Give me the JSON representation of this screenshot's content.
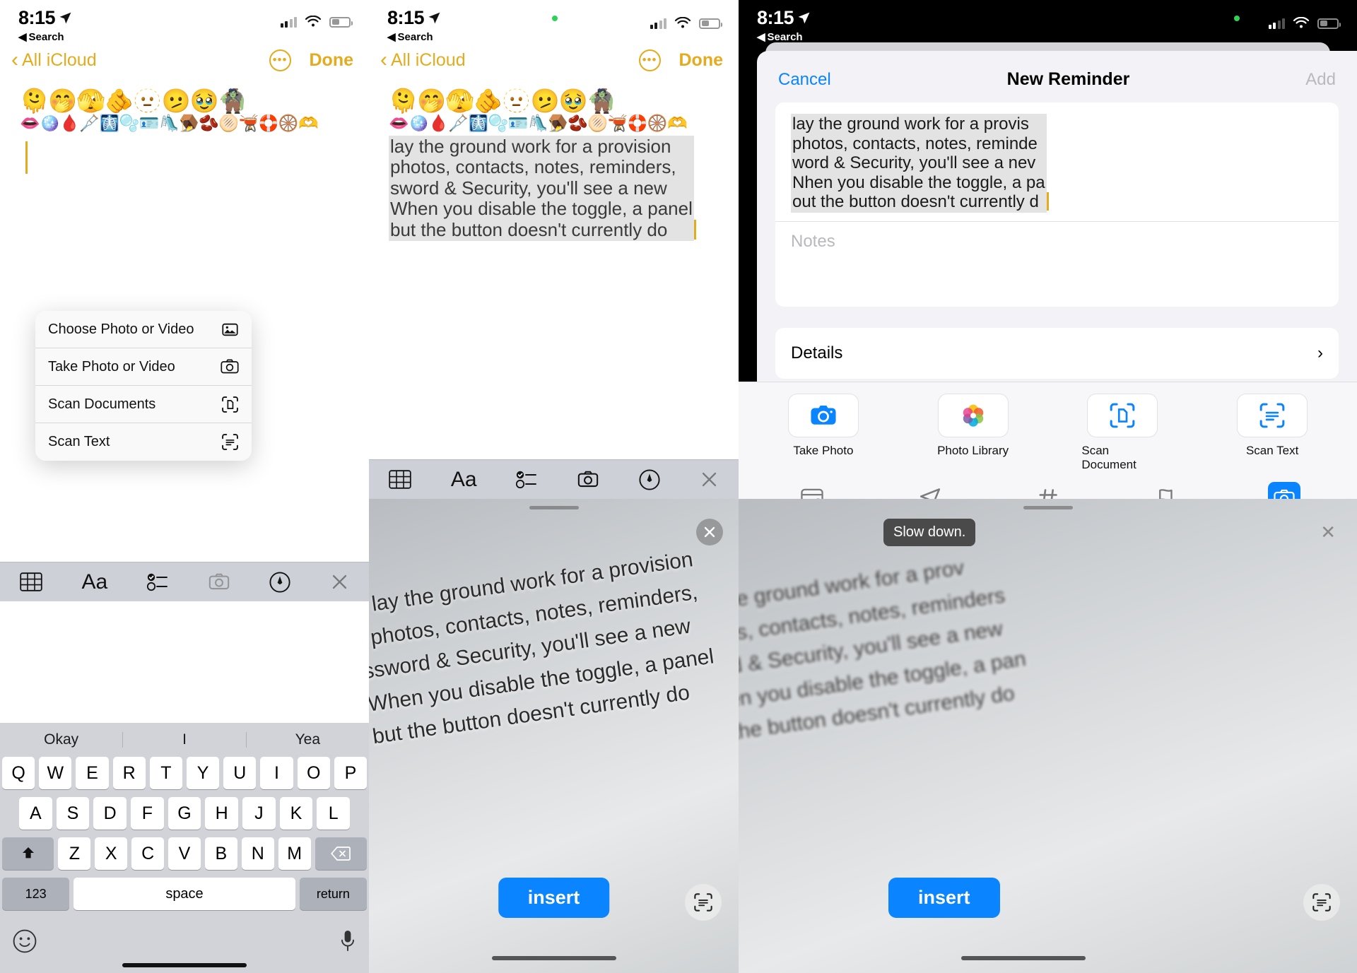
{
  "status_bar": {
    "time": "8:15",
    "location_icon": "location-arrow-icon",
    "back_label": "Search",
    "signal_icon": "cellular-signal-icon",
    "wifi_icon": "wifi-icon",
    "battery_icon": "battery-icon"
  },
  "notes": {
    "nav": {
      "back_label": "All iCloud",
      "more_icon": "ellipsis-circle-icon",
      "done_label": "Done"
    },
    "emoji_row_1": [
      "🫠",
      "🤭",
      "🫣",
      "🫵",
      "🫥",
      "🫤",
      "🥹",
      "🧌"
    ],
    "emoji_row_2": [
      "👄",
      "🪩",
      "🩸",
      "🩼",
      "🩻",
      "🫧",
      "🪪",
      "🛝",
      "🪤",
      "🫘",
      "🫓",
      "🫕",
      "🛟",
      "🛞",
      "🫶"
    ],
    "selected_text_lines": [
      "lay the ground work for a provision",
      "photos, contacts, notes, reminders,",
      "sword & Security, you'll see a new",
      "When you disable the toggle, a panel",
      "but the button doesn't currently do"
    ],
    "context_menu": [
      {
        "label": "Choose Photo or Video",
        "icon": "photo-icon"
      },
      {
        "label": "Take Photo or Video",
        "icon": "camera-icon"
      },
      {
        "label": "Scan Documents",
        "icon": "scan-document-icon"
      },
      {
        "label": "Scan Text",
        "icon": "scan-text-icon"
      }
    ],
    "toolbar": [
      {
        "icon": "table-icon",
        "name": "table-button"
      },
      {
        "icon": "text-format-icon",
        "name": "format-button",
        "glyph": "Aa"
      },
      {
        "icon": "checklist-icon",
        "name": "checklist-button"
      },
      {
        "icon": "camera-icon",
        "name": "camera-button"
      },
      {
        "icon": "markup-pen-icon",
        "name": "markup-button"
      },
      {
        "icon": "close-icon",
        "name": "close-keyboard-button"
      }
    ]
  },
  "keyboard": {
    "suggestions": [
      "Okay",
      "I",
      "Yea"
    ],
    "row1": [
      "Q",
      "W",
      "E",
      "R",
      "T",
      "Y",
      "U",
      "I",
      "O",
      "P"
    ],
    "row2": [
      "A",
      "S",
      "D",
      "F",
      "G",
      "H",
      "J",
      "K",
      "L"
    ],
    "row3": [
      "Z",
      "X",
      "C",
      "V",
      "B",
      "N",
      "M"
    ],
    "shift_icon": "shift-up-icon",
    "delete_icon": "delete-backspace-icon",
    "numbers_label": "123",
    "space_label": "space",
    "return_label": "return",
    "emoji_icon": "emoji-smiley-icon",
    "mic_icon": "microphone-icon"
  },
  "camera_scan": {
    "close_icon": "close-circle-icon",
    "insert_label": "insert",
    "scan_icon": "live-text-scan-icon",
    "tooltip": "Slow down.",
    "document_lines": [
      "o lay the ground work for a provision",
      ", photos, contacts, notes, reminders,",
      "ssword & Security, you'll see a new",
      "When you disable the toggle, a panel",
      "but the button doesn't currently do"
    ],
    "document_lines_right": [
      "y the ground work for a prov",
      "otos, contacts, notes, reminders",
      "ord & Security, you'll see a new",
      "hen you disable the toggle, a pan",
      "t the button doesn't currently do"
    ]
  },
  "reminder": {
    "cancel_label": "Cancel",
    "title": "New Reminder",
    "add_label": "Add",
    "title_lines": [
      "lay the ground work for a provis",
      "photos, contacts, notes, reminde",
      "word & Security, you'll see a nev",
      "Nhen you disable the toggle, a pa",
      "out the button doesn't currently d"
    ],
    "notes_placeholder": "Notes",
    "details_label": "Details",
    "details_chevron": "chevron-right-icon",
    "quick_actions": [
      {
        "label": "Take Photo",
        "icon": "camera-icon"
      },
      {
        "label": "Photo Library",
        "icon": "photos-app-icon"
      },
      {
        "label": "Scan Document",
        "icon": "scan-document-icon"
      },
      {
        "label": "Scan Text",
        "icon": "scan-text-icon"
      }
    ],
    "quick_icons": [
      {
        "name": "calendar-clock-icon"
      },
      {
        "name": "location-arrow-icon"
      },
      {
        "name": "hashtag-icon"
      },
      {
        "name": "flag-icon"
      },
      {
        "name": "camera-icon"
      }
    ]
  },
  "colors": {
    "notes_accent": "#e5ab1e",
    "ios_blue": "#0a84ff",
    "selection_gray": "#e3e3e3"
  }
}
